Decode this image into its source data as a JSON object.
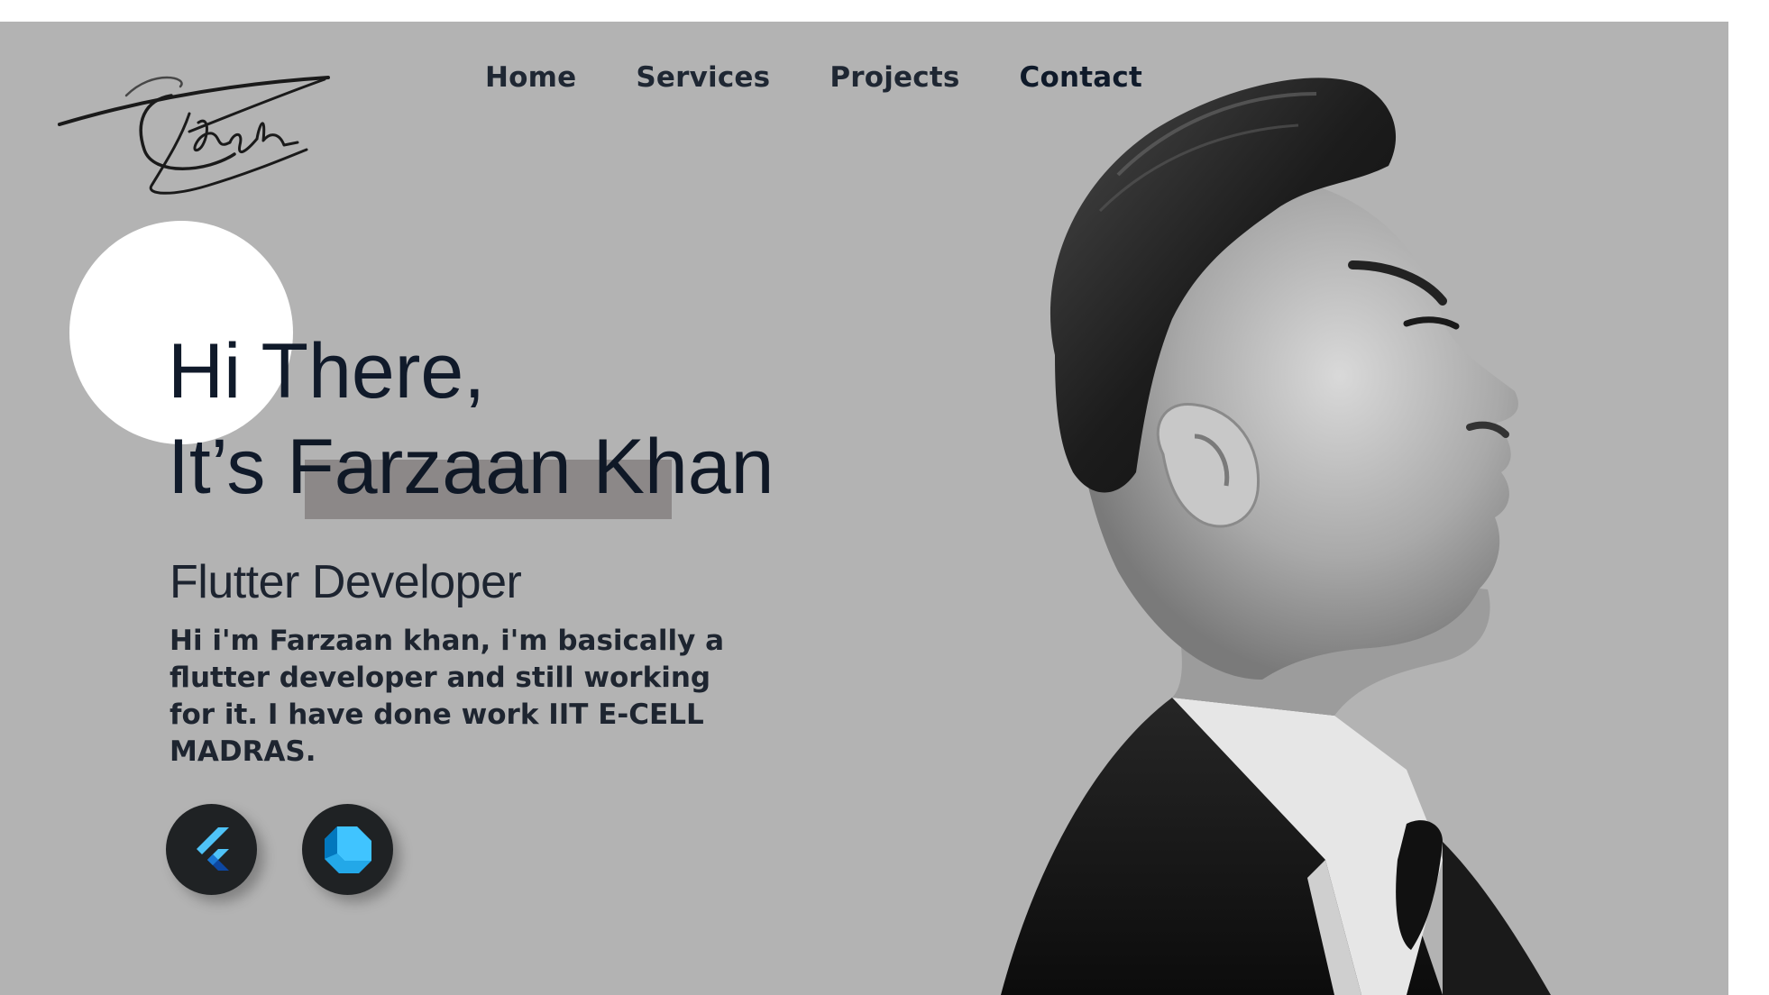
{
  "nav": {
    "items": [
      {
        "label": "Home"
      },
      {
        "label": "Services"
      },
      {
        "label": "Projects"
      },
      {
        "label": "Contact"
      }
    ]
  },
  "hero": {
    "greeting": "Hi There,",
    "intro_prefix": "It’s ",
    "name": "Farzaan Khan",
    "role": "Flutter Developer",
    "bio": "Hi i'm Farzaan khan, i'm basically a flutter developer and still working for it. I have done work IIT E-CELL MADRAS."
  },
  "skills": [
    {
      "icon": "flutter-icon",
      "color": "#29b6f6"
    },
    {
      "icon": "dart-icon",
      "color": "#40c4ff"
    }
  ],
  "colors": {
    "background": "#b3b3b3",
    "text": "#101a2a",
    "highlight": "#8c8888",
    "circle": "#ffffff"
  }
}
